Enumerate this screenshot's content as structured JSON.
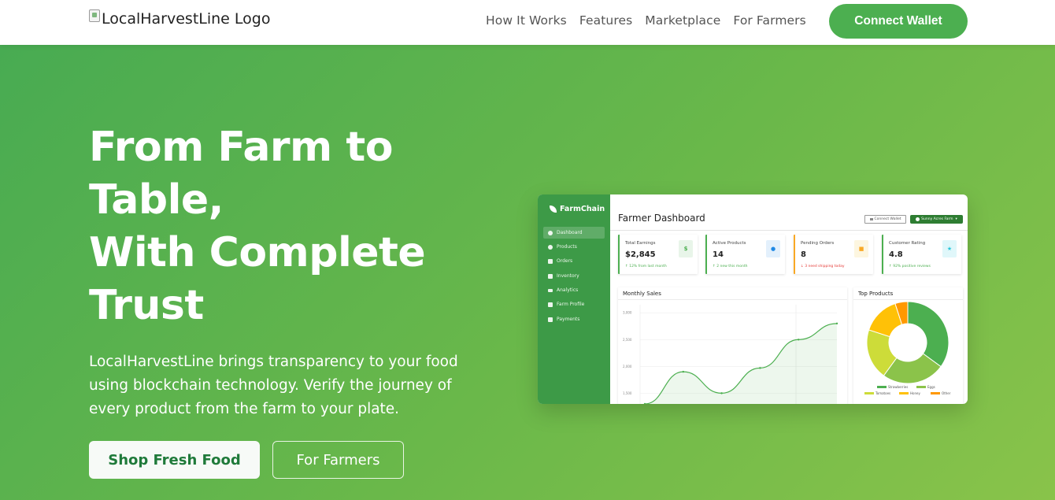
{
  "nav": {
    "logo_alt": "LocalHarvestLine Logo",
    "links": [
      "How It Works",
      "Features",
      "Marketplace",
      "For Farmers"
    ],
    "wallet_button": "Connect Wallet"
  },
  "hero": {
    "title_lines": [
      "From Farm to",
      "Table,",
      "With Complete",
      "Trust"
    ],
    "description": "LocalHarvestLine brings transparency to your food using blockchain technology. Verify the journey of every product from the farm to your plate.",
    "primary_button": "Shop Fresh Food",
    "secondary_button": "For Farmers"
  },
  "dashboard": {
    "brand": "FarmChain",
    "sidebar": [
      "Dashboard",
      "Products",
      "Orders",
      "Inventory",
      "Analytics",
      "Farm Profile",
      "Payments"
    ],
    "active_item": "Dashboard",
    "title": "Farmer Dashboard",
    "wallet_button": "Connect Wallet",
    "farm_button": "Sunny Acres Farm",
    "stats": [
      {
        "label": "Total Earnings",
        "value": "$2,845",
        "note": "↑ 12% from last month",
        "icon": "$",
        "icon_color": "#4caf50",
        "icon_bg": "#e8f5e9",
        "trend": "up"
      },
      {
        "label": "Active Products",
        "value": "14",
        "note": "↑ 2 new this month",
        "icon": "●",
        "icon_color": "#1e88e5",
        "icon_bg": "#e3f0fc",
        "trend": "up"
      },
      {
        "label": "Pending Orders",
        "value": "8",
        "note": "↓ 3 need shipping today",
        "icon": "■",
        "icon_color": "#f9a825",
        "icon_bg": "#fdf6e0",
        "trend": "down"
      },
      {
        "label": "Customer Rating",
        "value": "4.8",
        "note": "↑ 92% positive reviews",
        "icon": "★",
        "icon_color": "#26c6da",
        "icon_bg": "#e0f7fa",
        "trend": "up"
      }
    ],
    "sales_panel_title": "Monthly Sales",
    "products_panel_title": "Top Products"
  },
  "chart_data": [
    {
      "type": "area",
      "title": "Monthly Sales",
      "yticks": [
        "3,000",
        "2,500",
        "2,000",
        "1,500"
      ],
      "ylim": [
        1300,
        3150
      ],
      "x": [
        0,
        1,
        2,
        3,
        4,
        5
      ],
      "values": [
        1300,
        1900,
        1500,
        1970,
        2500,
        2800
      ],
      "color": "#4caf50"
    },
    {
      "type": "pie",
      "title": "Top Products",
      "categories": [
        "Strawberries",
        "Eggs",
        "Tomatoes",
        "Honey",
        "Other"
      ],
      "values": [
        35,
        25,
        20,
        15,
        5
      ],
      "colors": [
        "#4caf50",
        "#8bc34a",
        "#cddc39",
        "#ffc107",
        "#ff9800"
      ]
    }
  ]
}
